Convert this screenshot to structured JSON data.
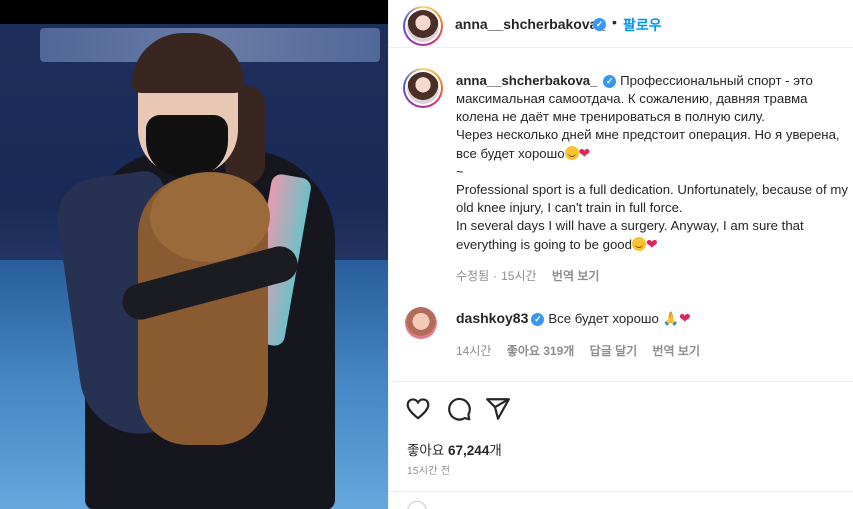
{
  "post": {
    "author": "anna__shcherbakova_",
    "follow_dot": "•",
    "follow_label": "팔로우"
  },
  "caption": {
    "ru_line1": "Профессиональный спорт - это максимальная самоотдача. К сожалению, давняя травма колена не даёт мне тренироваться в полную силу.",
    "ru_line2": "Через несколько дней мне предстоит операция. Но я уверена, все будет хорошо",
    "separator": "~",
    "en_line1": "Professional sport is a full dedication. Unfortunately, because of my old knee injury, I can't train in full force.",
    "en_line2": "In several days I will have a surgery. Anyway, I am sure that everything is going to be good",
    "heart": "❤",
    "meta_edited": "수정됨",
    "meta_time": "15시간",
    "meta_translate": "번역 보기"
  },
  "comment": {
    "username": "dashkoy83",
    "text": "Все будет хорошо 🙏",
    "heart": "❤",
    "time": "14시간",
    "likes_label": "좋아요 319개",
    "reply_label": "답글 달기",
    "translate_label": "번역 보기"
  },
  "actions": {
    "likes_prefix": "좋아요",
    "likes_count": "67,244",
    "likes_suffix": "개",
    "time_ago": "15시간 전"
  },
  "icons": {
    "like": "heart-outline-icon",
    "comment": "comment-bubble-icon",
    "share": "paper-plane-icon",
    "verified": "verified-badge-icon"
  },
  "colors": {
    "link_blue": "#0095f6",
    "verified_blue": "#3897f0",
    "heart_red": "#e0245e",
    "muted_gray": "#8e8e8e"
  }
}
